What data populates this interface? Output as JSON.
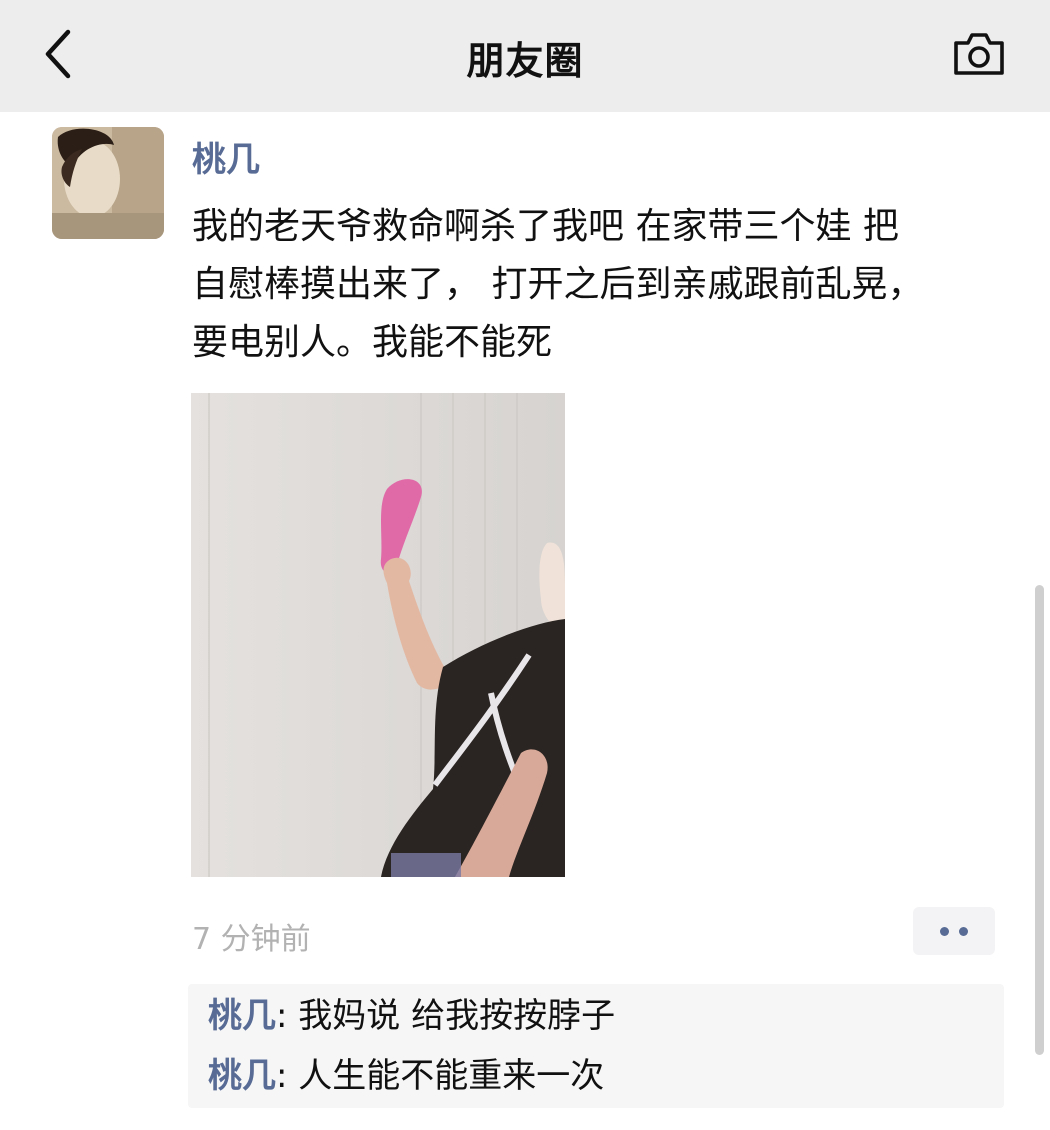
{
  "navbar": {
    "title": "朋友圈",
    "back_icon": "chevron-left-icon",
    "camera_icon": "camera-icon"
  },
  "post": {
    "author": "桃几",
    "text_lines": [
      "我的老天爷救命啊杀了我吧 在家带三个娃 把",
      "自慰棒摸出来了， 打开之后到亲戚跟前乱晃，",
      "要电别人。我能不能死"
    ],
    "time": "7 分钟前",
    "more_icon": "more-dots-icon"
  },
  "comments": [
    {
      "name": "桃几",
      "separator": ": ",
      "text": "我妈说 给我按按脖子"
    },
    {
      "name": "桃几",
      "separator": ": ",
      "text": "人生能不能重来一次"
    }
  ],
  "colors": {
    "navbar_bg": "#ededed",
    "link_blue": "#576b95",
    "timestamp_gray": "#b2b2b2",
    "comment_bg": "#f6f6f6"
  }
}
